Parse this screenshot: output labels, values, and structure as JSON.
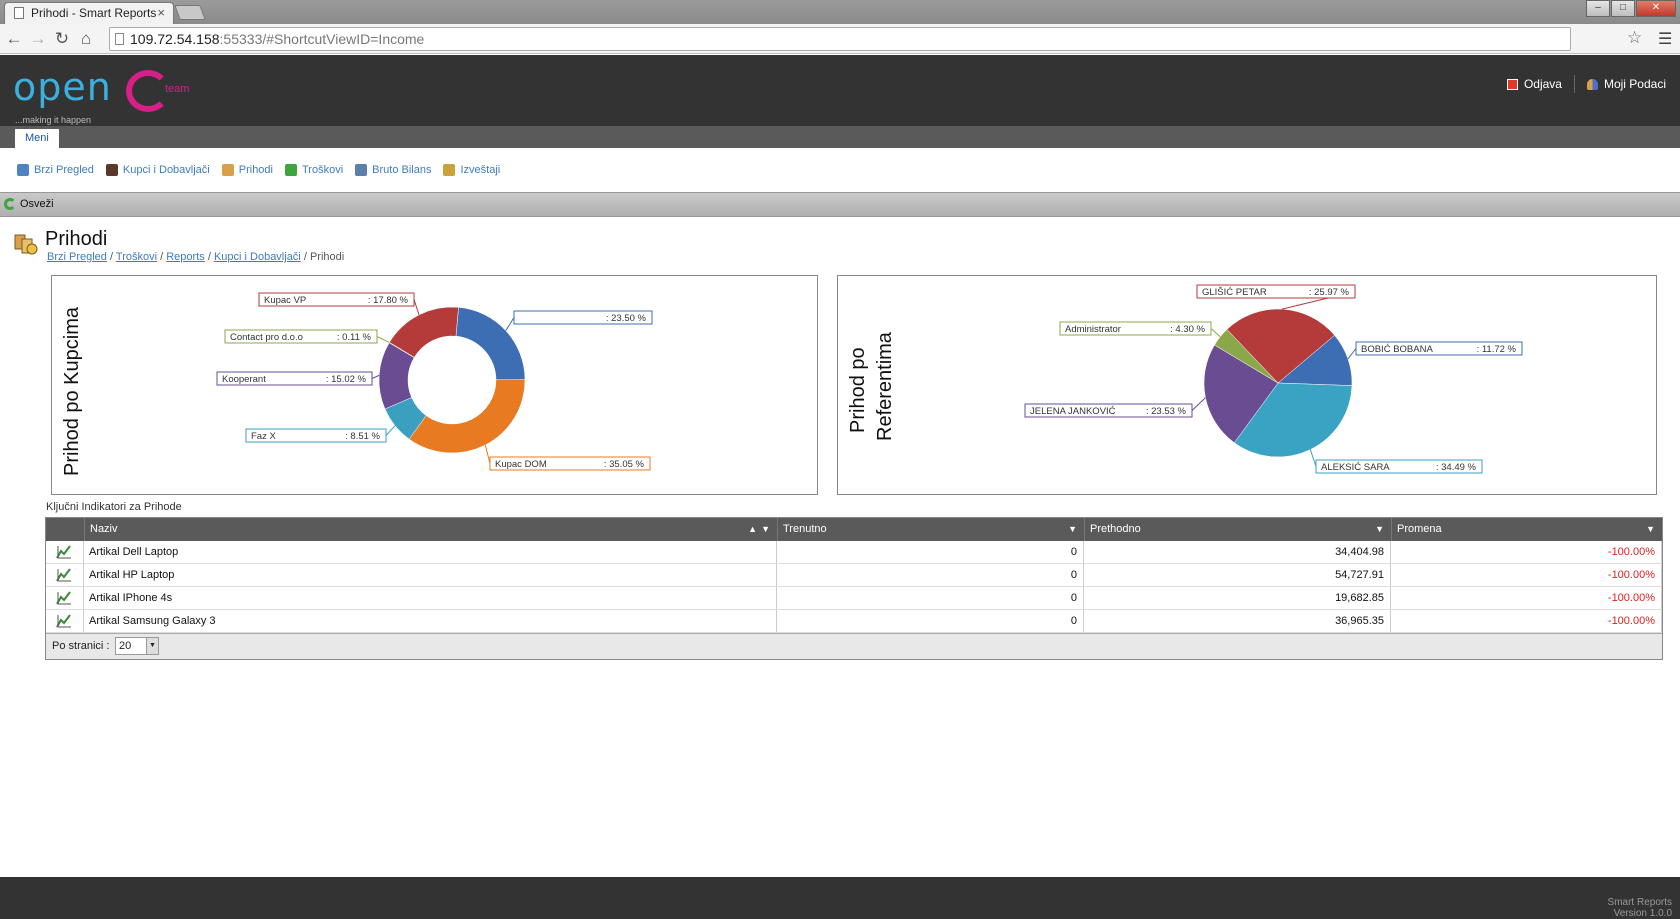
{
  "browser": {
    "tab_title": "Prihodi - Smart Reports",
    "url_host": "109.72.54.158",
    "url_rest": ":55333/#ShortcutViewID=Income"
  },
  "header": {
    "logo_main": "open",
    "logo_team": "team",
    "logo_tagline": "...making it happen",
    "logout_label": "Odjava",
    "profile_label": "Moji Podaci"
  },
  "menu": {
    "tab_label": "Meni"
  },
  "ribbon": {
    "items": [
      {
        "label": "Brzi Pregled",
        "color": "#4f84c4"
      },
      {
        "label": "Kupci i Dobavljači",
        "color": "#5a3a2a"
      },
      {
        "label": "Prihodi",
        "color": "#d8a04a"
      },
      {
        "label": "Troškovi",
        "color": "#3ea53e"
      },
      {
        "label": "Bruto Bilans",
        "color": "#5a7fa8"
      },
      {
        "label": "Izveštaji",
        "color": "#c9a23a"
      }
    ]
  },
  "toolbar": {
    "refresh_label": "Osveži"
  },
  "page": {
    "title": "Prihodi",
    "breadcrumb": [
      "Brzi Pregled",
      "Troškovi",
      "Reports",
      "Kupci i Dobavljači"
    ],
    "breadcrumb_current": "Prihodi"
  },
  "chart_data": [
    {
      "type": "pie",
      "donut": true,
      "title": "Prihod po Kupcima",
      "slices": [
        {
          "label": "",
          "value": 23.5,
          "display": ": 23.50 %",
          "color": "#3d6eb4"
        },
        {
          "label": "Kupac DOM",
          "value": 35.05,
          "display": ": 35.05 %",
          "color": "#e87a22"
        },
        {
          "label": "Faz X",
          "value": 8.51,
          "display": ": 8.51 %",
          "color": "#3b9fc0"
        },
        {
          "label": "Kooperant",
          "value": 15.02,
          "display": ": 15.02 %",
          "color": "#6a4c93"
        },
        {
          "label": "Contact pro d.o.o",
          "value": 0.11,
          "display": ": 0.11 %",
          "color": "#8aa84a"
        },
        {
          "label": "Kupac VP",
          "value": 17.8,
          "display": ": 17.80 %",
          "color": "#b53a3a"
        }
      ]
    },
    {
      "type": "pie",
      "donut": false,
      "title": "Prihod po Referentima",
      "slices": [
        {
          "label": "BOBIĆ BOBANA",
          "value": 11.72,
          "display": ": 11.72 %",
          "color": "#3d6eb4"
        },
        {
          "label": "ALEKSIĆ SARA",
          "value": 34.49,
          "display": ": 34.49 %",
          "color": "#3aa2c2"
        },
        {
          "label": "JELENA JANKOVIĆ",
          "value": 23.53,
          "display": ": 23.53 %",
          "color": "#6a4c93"
        },
        {
          "label": "Administrator",
          "value": 4.3,
          "display": ": 4.30 %",
          "color": "#8aa84a"
        },
        {
          "label": "GLIŠIĆ PETAR",
          "value": 25.97,
          "display": ": 25.97 %",
          "color": "#b53a3a"
        }
      ]
    }
  ],
  "kpi": {
    "title": "Ključni Indikatori za Prihode",
    "columns": [
      "Naziv",
      "Trenutno",
      "Prethodno",
      "Promena"
    ],
    "rows": [
      {
        "name": "Artikal Dell Laptop",
        "current": "0",
        "previous": "34,404.98",
        "change": "-100.00%"
      },
      {
        "name": "Artikal HP Laptop",
        "current": "0",
        "previous": "54,727.91",
        "change": "-100.00%"
      },
      {
        "name": "Artikal IPhone 4s",
        "current": "0",
        "previous": "19,682.85",
        "change": "-100.00%"
      },
      {
        "name": "Artikal Samsung Galaxy 3",
        "current": "0",
        "previous": "36,965.35",
        "change": "-100.00%"
      }
    ],
    "pager_label": "Po stranici :",
    "page_size": "20"
  },
  "footer": {
    "line1": "Smart Reports",
    "line2": "Version 1.0.0"
  }
}
